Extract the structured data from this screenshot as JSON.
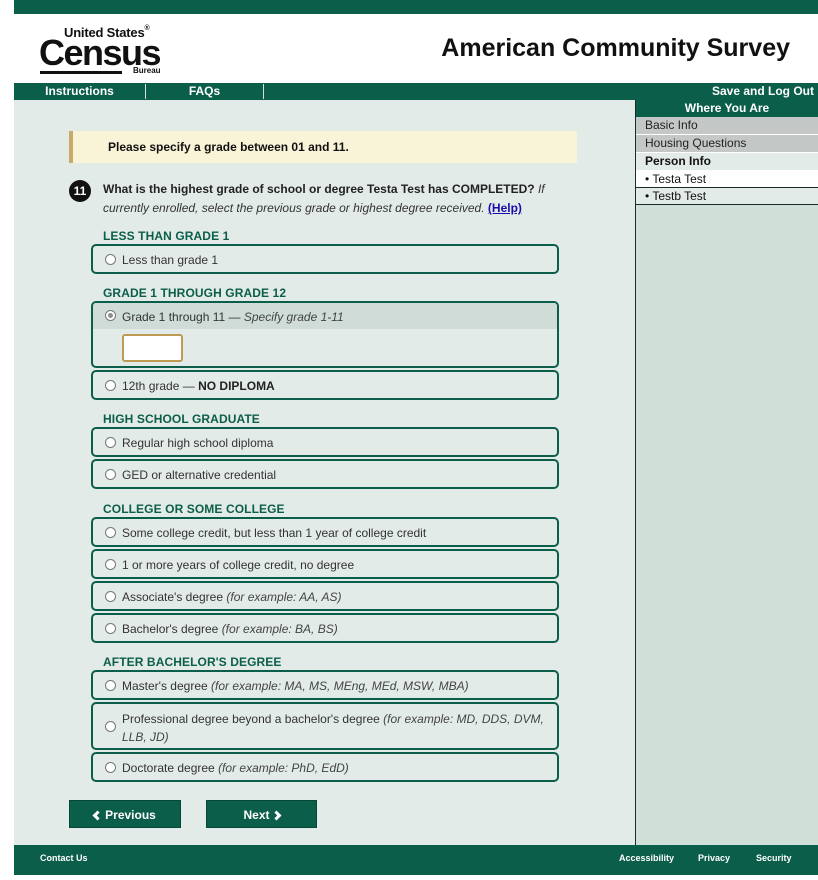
{
  "header": {
    "logo": {
      "top": "United States",
      "reg": "®",
      "main": "Census",
      "sub": "Bureau"
    },
    "title": "American Community Survey"
  },
  "nav": {
    "instructions": "Instructions",
    "faqs": "FAQs",
    "save_logout": "Save and Log Out"
  },
  "error": {
    "message": "Please specify a grade between 01 and 11."
  },
  "question": {
    "number": "11",
    "text_bold": "What is the highest grade of school or degree Testa Test has COMPLETED?",
    "text_italic": "If currently enrolled, select the previous grade or highest degree received.",
    "help_label": "(Help)"
  },
  "groups": {
    "less_than_grade_1": "LESS THAN GRADE 1",
    "grade_1_12": "GRADE 1 THROUGH GRADE 12",
    "high_school": "HIGH SCHOOL GRADUATE",
    "college": "COLLEGE OR SOME COLLEGE",
    "after_bachelors": "AFTER BACHELOR'S DEGREE"
  },
  "options": {
    "less_than_grade_1": {
      "label": "Less than grade 1"
    },
    "grade_1_11": {
      "label": "Grade 1 through 11 — ",
      "note": "Specify grade 1-11",
      "selected": true,
      "input_value": ""
    },
    "grade_12": {
      "label": "12th grade — ",
      "strong": "NO DIPLOMA"
    },
    "regular_diploma": {
      "label": "Regular high school diploma"
    },
    "ged": {
      "label": "GED or alternative credential"
    },
    "some_college": {
      "label": "Some college credit, but less than 1 year of college credit"
    },
    "one_or_more_years": {
      "label": "1 or more years of college credit, no degree"
    },
    "associates": {
      "label": "Associate's degree ",
      "note": "(for example: AA, AS)"
    },
    "bachelors": {
      "label": "Bachelor's degree ",
      "note": "(for example: BA, BS)"
    },
    "masters": {
      "label": "Master's degree ",
      "note": "(for example: MA, MS, MEng, MEd, MSW, MBA)"
    },
    "professional": {
      "label": "Professional degree beyond a bachelor's degree ",
      "note": "(for example: MD, DDS, DVM, LLB, JD)"
    },
    "doctorate": {
      "label": "Doctorate degree ",
      "note": "(for example: PhD, EdD)"
    }
  },
  "buttons": {
    "previous": "Previous",
    "next": "Next"
  },
  "sidebar": {
    "title": "Where You Are",
    "items": [
      "Basic Info",
      "Housing Questions",
      "Person Info"
    ],
    "persons": [
      "• Testa Test",
      "• Testb Test"
    ]
  },
  "footer": {
    "contact": "Contact Us",
    "accessibility": "Accessibility",
    "privacy": "Privacy",
    "security": "Security"
  },
  "colors": {
    "brand_green": "#0b5e4a",
    "content_bg": "#e3ebe8",
    "sidebar_bg": "#cfe0d9",
    "error_bg": "#f9f3d7",
    "error_accent": "#c8a96a",
    "input_border": "#bf9a52"
  }
}
